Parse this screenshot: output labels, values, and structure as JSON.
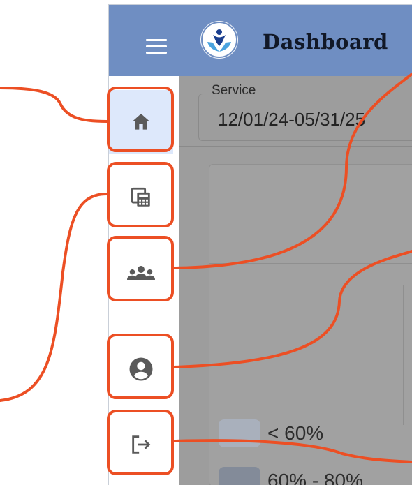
{
  "header": {
    "title": "Dashboard",
    "menu_icon": "hamburger-menu-icon",
    "logo_icon": "person-in-hands-logo"
  },
  "sidebar": {
    "items": [
      {
        "icon": "home-icon",
        "active": true
      },
      {
        "icon": "calculator-copy-icon",
        "active": false
      },
      {
        "icon": "group-icon",
        "active": false
      },
      {
        "icon": "account-circle-icon",
        "active": false
      },
      {
        "icon": "logout-icon",
        "active": false
      }
    ]
  },
  "service_field": {
    "label": "Service",
    "value": "12/01/24-05/31/25"
  },
  "legend": [
    {
      "label": "< 60%",
      "color": "#a9b0bc"
    },
    {
      "label": "60% - 80%",
      "color": "#838b99"
    }
  ],
  "colors": {
    "topbar": "#6f8ec2",
    "active_nav": "#dde8fb",
    "icon": "#5f5f5f",
    "overlay": "#9d9d9d",
    "callout": "#ec4f24"
  }
}
